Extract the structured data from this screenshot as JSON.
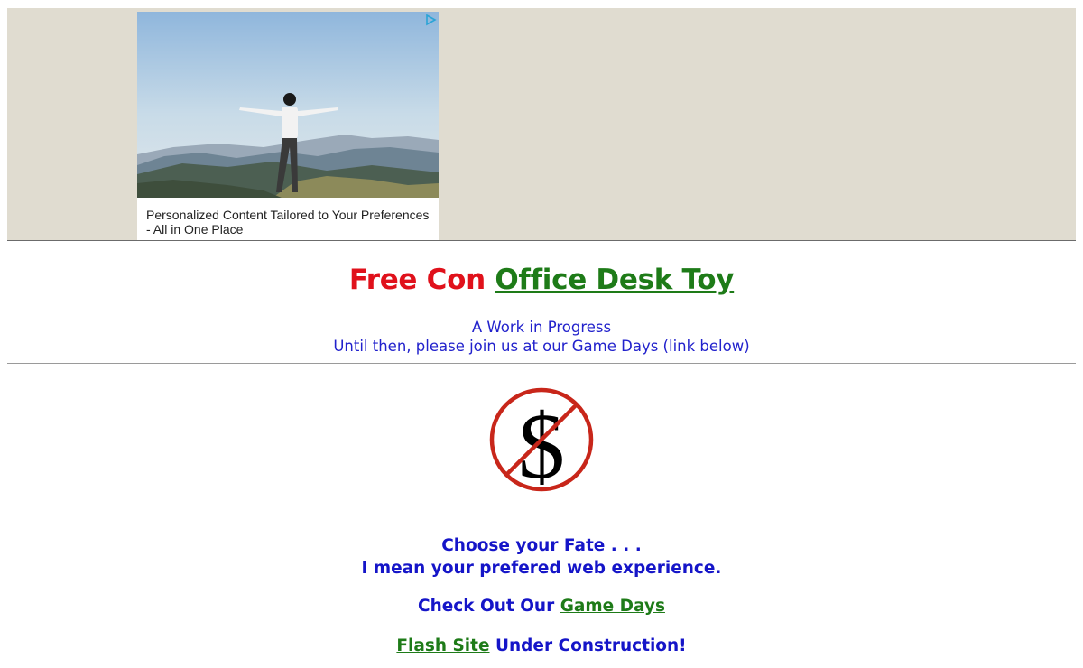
{
  "ad": {
    "caption": "Personalized Content Tailored to Your Preferences - All in One Place",
    "choices_icon": "ad-choices-icon",
    "image": "person-on-mountain-photo"
  },
  "header": {
    "title_part1": "Free",
    "title_part2": "Con",
    "title_link": "Office Desk Toy",
    "subtitle_line1": "A Work in Progress",
    "subtitle_line2": "Until then, please join us at our Game Days (link below)"
  },
  "logo": {
    "icon": "no-dollar-icon",
    "symbol": "$"
  },
  "experience": {
    "line1": "Choose your Fate . . .",
    "line2": "I mean your prefered web experience.",
    "gamedays_prefix": "Check Out Our",
    "gamedays_link": "Game Days",
    "flash_link": "Flash Site",
    "flash_suffix": "Under Construction!"
  },
  "colors": {
    "ad_background": "#e0dcd0",
    "title_red": "#e0111b",
    "link_green": "#1e7b18",
    "text_blue": "#1515c8",
    "no_sign_red": "#c8261a"
  }
}
